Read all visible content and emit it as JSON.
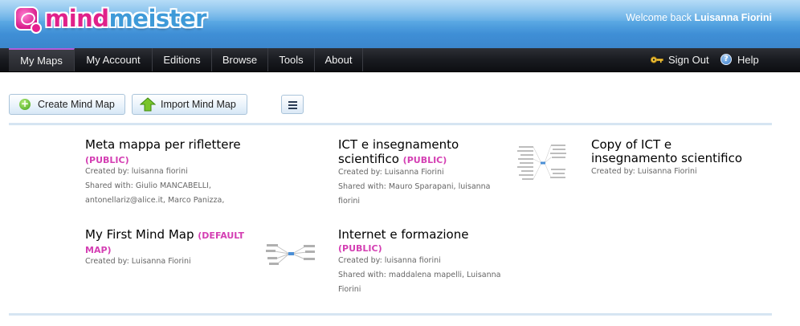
{
  "header": {
    "logo_mind": "mind",
    "logo_meister": "meister",
    "welcome_prefix": "Welcome back",
    "welcome_user": "Luisanna Fiorini"
  },
  "nav": {
    "tabs": [
      {
        "label": "My Maps",
        "active": true
      },
      {
        "label": "My Account",
        "active": false
      },
      {
        "label": "Editions",
        "active": false
      },
      {
        "label": "Browse",
        "active": false
      },
      {
        "label": "Tools",
        "active": false
      },
      {
        "label": "About",
        "active": false
      }
    ],
    "sign_out": "Sign Out",
    "help": "Help"
  },
  "toolbar": {
    "create_label": "Create Mind Map",
    "import_label": "Import Mind Map",
    "view_icon": "list-view-icon"
  },
  "maps": [
    {
      "title": "Meta mappa per riflettere",
      "badge": "(PUBLIC)",
      "created": "Created by: luisanna fiorini",
      "shared_1": "Shared with: Giulio MANCABELLI,",
      "shared_2": "antonellariz@alice.it, Marco Panizza,"
    },
    {
      "title_1": "ICT e insegnamento",
      "title_2": "scientifico",
      "badge": "(PUBLIC)",
      "created": "Created by: Luisanna Fiorini",
      "shared_1": "Shared with: Mauro Sparapani, luisanna",
      "shared_2": "fiorini"
    },
    {
      "title_1": "Copy of ICT e",
      "title_2": "insegnamento scientifico",
      "created": "Created by: Luisanna Fiorini"
    },
    {
      "title": "My First Mind Map",
      "badge_1": "(DEFAULT",
      "badge_2": "MAP)",
      "created": "Created by: Luisanna Fiorini"
    },
    {
      "title": "Internet e formazione",
      "badge": "(PUBLIC)",
      "created": "Created by: luisanna fiorini",
      "shared_1": "Shared with: maddalena mapelli, Luisanna",
      "shared_2": "Fiorini"
    }
  ],
  "colors": {
    "header_blue": "#4a9ce0",
    "nav_dark": "#1a1c21",
    "badge_pink": "#d43fb3",
    "divider": "#d6e5f2"
  }
}
